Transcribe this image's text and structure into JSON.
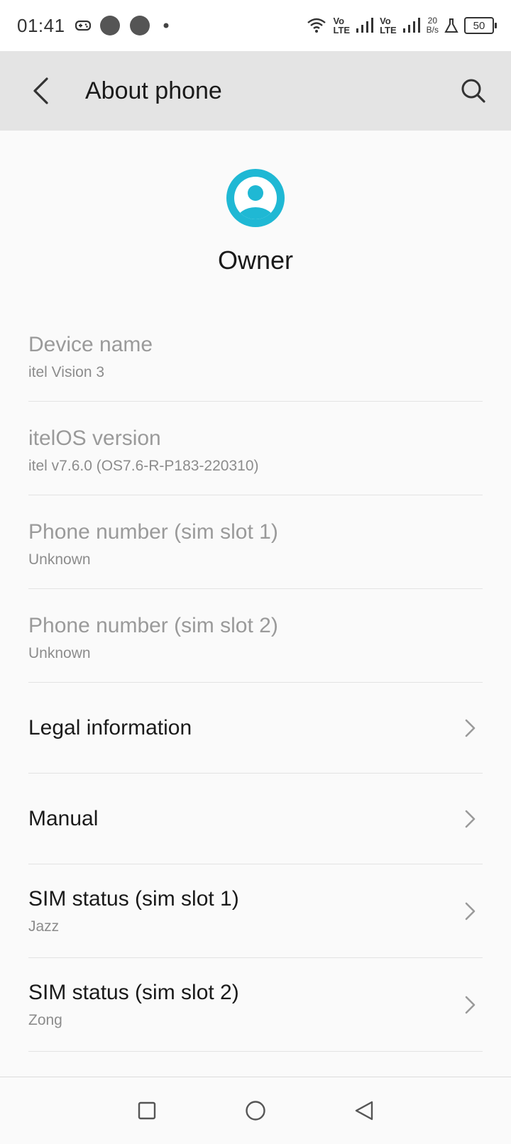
{
  "status_bar": {
    "time": "01:41",
    "volte_top": "Vo",
    "volte_bottom": "LTE",
    "speed_value": "20",
    "speed_unit": "B/s",
    "battery": "50"
  },
  "app_bar": {
    "title": "About phone"
  },
  "profile": {
    "name": "Owner",
    "accent_color": "#1fb8d4"
  },
  "info_rows": [
    {
      "title": "Device name",
      "value": "itel Vision 3"
    },
    {
      "title": "itelOS version",
      "value": "itel v7.6.0 (OS7.6-R-P183-220310)"
    },
    {
      "title": "Phone number (sim slot 1)",
      "value": "Unknown"
    },
    {
      "title": "Phone number (sim slot 2)",
      "value": "Unknown"
    }
  ],
  "nav_rows": [
    {
      "title": "Legal information",
      "value": ""
    },
    {
      "title": "Manual",
      "value": ""
    },
    {
      "title": "SIM status (sim slot 1)",
      "value": "Jazz"
    },
    {
      "title": "SIM status (sim slot 2)",
      "value": "Zong"
    }
  ],
  "icons": {
    "back": "arrow-back-icon",
    "search": "search-icon",
    "chevron": "chevron-right-icon",
    "nav_recent": "square-icon",
    "nav_home": "circle-icon",
    "nav_back": "triangle-back-icon"
  }
}
